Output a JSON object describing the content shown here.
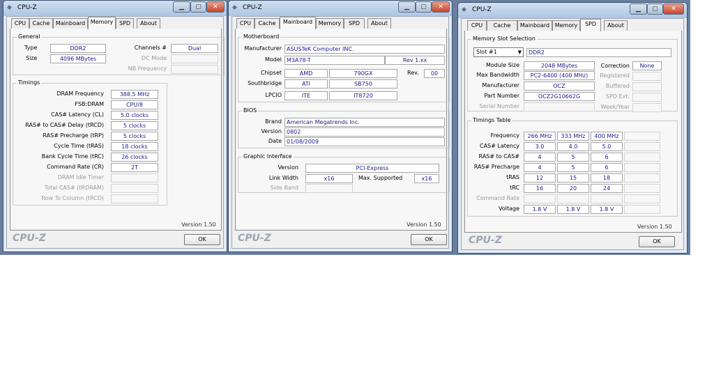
{
  "title": "CPU-Z",
  "logo": "CPU-Z",
  "version": "Version 1.50",
  "ok": "OK",
  "caption_buttons": {
    "min": "▁",
    "max": "▢",
    "close": "✕"
  },
  "w1": {
    "tabs": [
      "CPU",
      "Cache",
      "Mainboard",
      "Memory",
      "SPD",
      "About"
    ],
    "general": {
      "title": "General",
      "type_lbl": "Type",
      "type": "DDR2",
      "size_lbl": "Size",
      "size": "4096 MBytes",
      "channels_lbl": "Channels #",
      "channels": "Dual",
      "dcmode_lbl": "DC Mode",
      "nbfreq_lbl": "NB Frequency"
    },
    "timings": {
      "title": "Timings",
      "rows": [
        {
          "label": "DRAM Frequency",
          "value": "388.5 MHz"
        },
        {
          "label": "FSB:DRAM",
          "value": "CPU/8"
        },
        {
          "label": "CAS# Latency (CL)",
          "value": "5.0 clocks"
        },
        {
          "label": "RAS# to CAS# Delay (tRCD)",
          "value": "5 clocks"
        },
        {
          "label": "RAS# Precharge (tRP)",
          "value": "5 clocks"
        },
        {
          "label": "Cycle Time (tRAS)",
          "value": "18 clocks"
        },
        {
          "label": "Bank Cycle Time (tRC)",
          "value": "26 clocks"
        },
        {
          "label": "Command Rate (CR)",
          "value": "2T"
        },
        {
          "label": "DRAM Idle Timer",
          "value": ""
        },
        {
          "label": "Total CAS# (tRDRAM)",
          "value": ""
        },
        {
          "label": "Row To Column (tRCD)",
          "value": ""
        }
      ]
    }
  },
  "w2": {
    "tabs": [
      "CPU",
      "Cache",
      "Mainboard",
      "Memory",
      "SPD",
      "About"
    ],
    "mb": {
      "title": "Motherboard",
      "manuf_lbl": "Manufacturer",
      "manuf": "ASUSTeK Computer INC.",
      "model_lbl": "Model",
      "model": "M3A78-T",
      "model_rev": "Rev 1.xx",
      "chipset_lbl": "Chipset",
      "chipset_v": "AMD",
      "chipset_m": "790GX",
      "rev_lbl": "Rev.",
      "rev": "00",
      "south_lbl": "Southbridge",
      "south_v": "ATI",
      "south_m": "SB750",
      "lpcio_lbl": "LPCIO",
      "lpcio_v": "ITE",
      "lpcio_m": "IT8720"
    },
    "bios": {
      "title": "BIOS",
      "brand_lbl": "Brand",
      "brand": "American Megatrends Inc.",
      "version_lbl": "Version",
      "version": "0802",
      "date_lbl": "Date",
      "date": "01/08/2009"
    },
    "gi": {
      "title": "Graphic Interface",
      "version_lbl": "Version",
      "version": "PCI-Express",
      "lw_lbl": "Link Width",
      "lw": "x16",
      "ms_lbl": "Max. Supported",
      "ms": "x16",
      "sb_lbl": "Side Band"
    }
  },
  "w3": {
    "tabs": [
      "CPU",
      "Cache",
      "Mainboard",
      "Memory",
      "SPD",
      "About"
    ],
    "slot": {
      "title": "Memory Slot Selection",
      "slot": "Slot #1",
      "type": "DDR2",
      "modsize_lbl": "Module Size",
      "modsize": "2048 MBytes",
      "maxbw_lbl": "Max Bandwidth",
      "maxbw": "PC2-6400 (400 MHz)",
      "manuf_lbl": "Manufacturer",
      "manuf": "OCZ",
      "part_lbl": "Part Number",
      "part": "OCZ2G10662G",
      "serial_lbl": "Serial Number",
      "corr_lbl": "Correction",
      "corr": "None",
      "reg_lbl": "Registered",
      "buf_lbl": "Buffered",
      "spdext_lbl": "SPD Ext.",
      "week_lbl": "Week/Year"
    },
    "tt": {
      "title": "Timings Table",
      "rows": [
        {
          "label": "Frequency",
          "v": [
            "266 MHz",
            "333 MHz",
            "400 MHz"
          ]
        },
        {
          "label": "CAS# Latency",
          "v": [
            "3.0",
            "4.0",
            "5.0"
          ]
        },
        {
          "label": "RAS# to CAS#",
          "v": [
            "4",
            "5",
            "6"
          ]
        },
        {
          "label": "RAS# Precharge",
          "v": [
            "4",
            "5",
            "6"
          ]
        },
        {
          "label": "tRAS",
          "v": [
            "12",
            "15",
            "18"
          ]
        },
        {
          "label": "tRC",
          "v": [
            "16",
            "20",
            "24"
          ]
        },
        {
          "label": "Command Rate",
          "v": [
            "",
            "",
            ""
          ]
        },
        {
          "label": "Voltage",
          "v": [
            "1.8 V",
            "1.8 V",
            "1.8 V"
          ]
        }
      ]
    }
  }
}
